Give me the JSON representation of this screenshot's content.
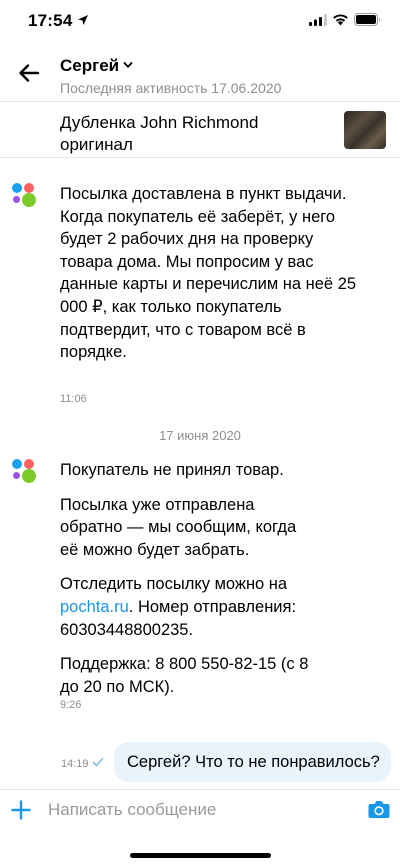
{
  "status_bar": {
    "time": "17:54"
  },
  "header": {
    "contact_name": "Сергей",
    "last_seen": "Последняя активность 17.06.2020"
  },
  "item": {
    "title": "Дубленка John Richmond оригинал"
  },
  "messages": [
    {
      "paragraphs": [
        "Посылка доставлена в пункт выдачи. Когда покупатель её заберёт, у него будет 2 рабочих дня на проверку товара дома. Мы попросим у вас данные карты и перечислим на неё 25 000 ₽, как только покупатель подтвердит, что с товаром всё в порядке."
      ],
      "time": "11:06"
    },
    {
      "p1": "Покупатель не принял товар.",
      "p2": "Посылка уже отправлена обратно — мы сообщим, когда её можно будет забрать.",
      "p3_before": "Отследить посылку можно на ",
      "p3_link": "pochta.ru",
      "p3_after": ". Номер отправления: 60303448800235.",
      "p4": "Поддержка: 8 800 550-82-15 (с 8 до 20 по МСК).",
      "time": "9:26"
    }
  ],
  "date_separator": "17 июня 2020",
  "outgoing": {
    "text": "Сергей? Что то не понравилось?",
    "time": "14:19"
  },
  "composer": {
    "placeholder": "Написать сообщение"
  },
  "colors": {
    "accent": "#1a97e8",
    "bubble": "#e8f3fc"
  },
  "icons": [
    "location-arrow-icon",
    "signal-icon",
    "wifi-icon",
    "battery-icon",
    "back-arrow-icon",
    "chevron-down-icon",
    "bot-avatar-icon",
    "checkmark-icon",
    "plus-icon",
    "camera-icon"
  ]
}
